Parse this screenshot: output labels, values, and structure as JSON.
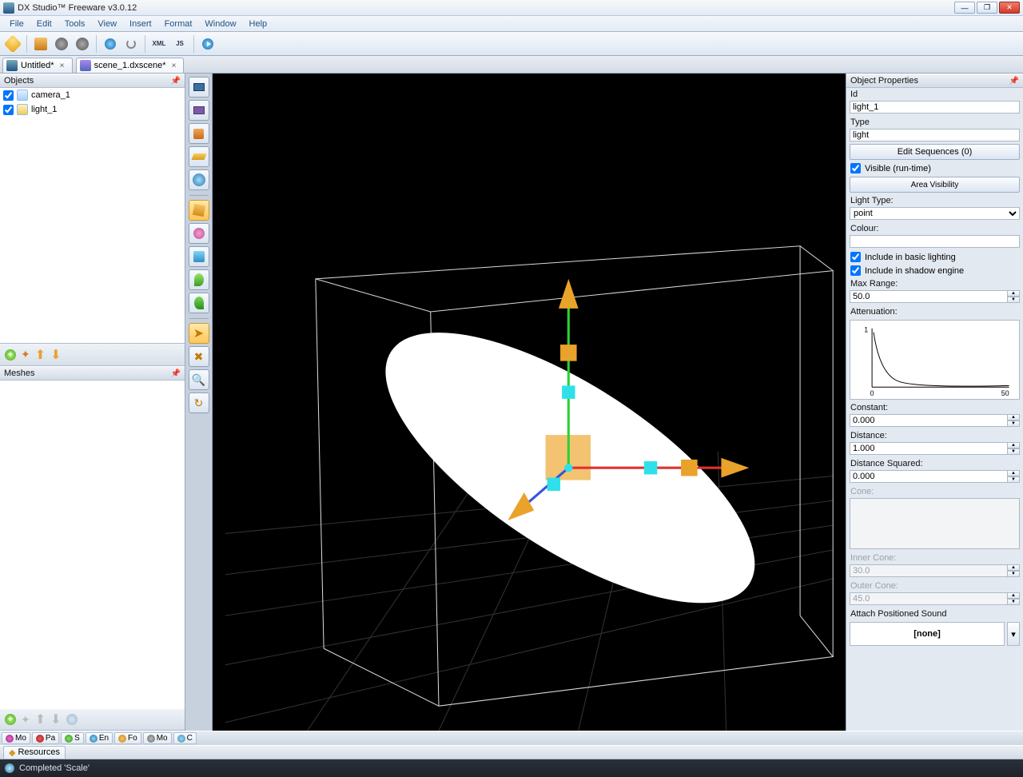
{
  "window": {
    "title": "DX Studio™ Freeware v3.0.12"
  },
  "menu": [
    "File",
    "Edit",
    "Tools",
    "View",
    "Insert",
    "Format",
    "Window",
    "Help"
  ],
  "tabs": [
    {
      "label": "Untitled*",
      "active": false
    },
    {
      "label": "scene_1.dxscene*",
      "active": true
    }
  ],
  "panels": {
    "objects_title": "Objects",
    "meshes_title": "Meshes"
  },
  "objects": [
    {
      "name": "camera_1",
      "checked": true
    },
    {
      "name": "light_1",
      "checked": true
    }
  ],
  "properties": {
    "title": "Object Properties",
    "id_label": "Id",
    "id_value": "light_1",
    "type_label": "Type",
    "type_value": "light",
    "edit_sequences": "Edit Sequences (0)",
    "visible_runtime": "Visible (run-time)",
    "area_visibility": "Area Visibility",
    "light_type_label": "Light Type:",
    "light_type_value": "point",
    "colour_label": "Colour:",
    "include_basic": "Include in basic lighting",
    "include_shadow": "Include in shadow engine",
    "max_range_label": "Max Range:",
    "max_range_value": "50.0",
    "attenuation_label": "Attenuation:",
    "atten_axis_min": "0",
    "atten_axis_max": "50",
    "atten_y_max": "1",
    "constant_label": "Constant:",
    "constant_value": "0.000",
    "distance_label": "Distance:",
    "distance_value": "1.000",
    "distance_sq_label": "Distance Squared:",
    "distance_sq_value": "0.000",
    "cone_label": "Cone:",
    "inner_cone_label": "Inner Cone:",
    "inner_cone_value": "30.0",
    "outer_cone_label": "Outer Cone:",
    "outer_cone_value": "45.0",
    "attach_sound_label": "Attach Positioned Sound",
    "attach_sound_value": "[none]"
  },
  "bottom_tabs": [
    "Mo",
    "Pa",
    "S",
    "En",
    "Fo",
    "Mo",
    "C"
  ],
  "resources_label": "Resources",
  "status": "Completed 'Scale'"
}
